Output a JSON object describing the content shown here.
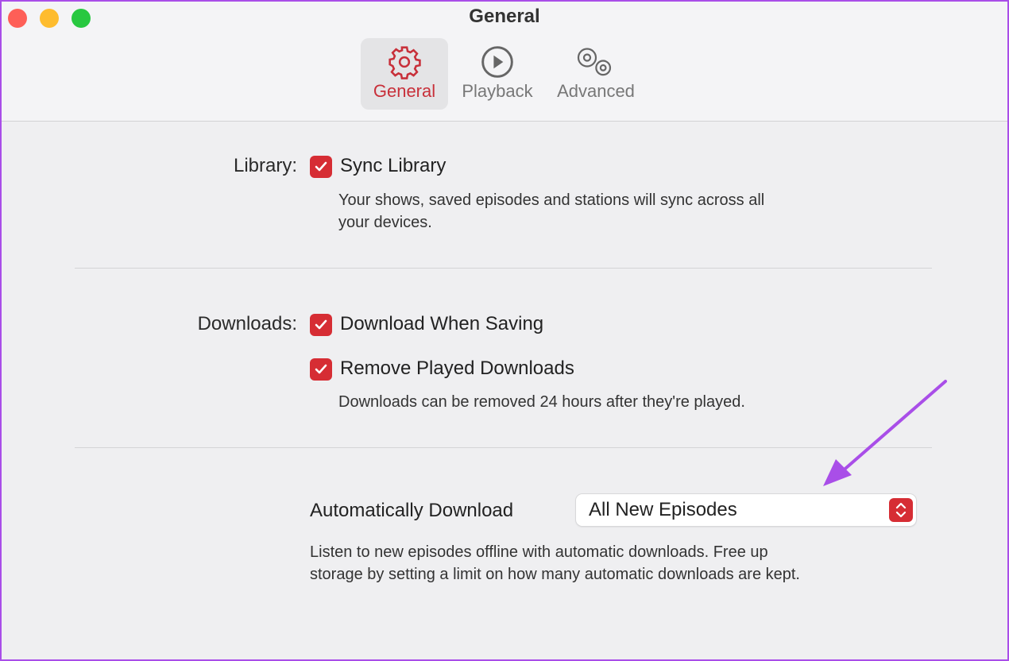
{
  "window": {
    "title": "General"
  },
  "tabs": [
    {
      "label": "General",
      "icon": "gear-icon",
      "selected": true
    },
    {
      "label": "Playback",
      "icon": "play-circle-icon"
    },
    {
      "label": "Advanced",
      "icon": "gears-icon"
    }
  ],
  "library": {
    "label": "Library:",
    "option": "Sync Library",
    "checked": true,
    "description_1": "Your shows, saved episodes and stations will sync across all",
    "description_2": "your devices."
  },
  "downloads": {
    "label": "Downloads:",
    "option1": "Download When Saving",
    "option1_checked": true,
    "option2": "Remove Played Downloads",
    "option2_checked": true,
    "description": "Downloads can be removed 24 hours after they're played."
  },
  "auto": {
    "label": "Automatically Download",
    "value": "All New Episodes",
    "description_1": "Listen to new episodes offline with automatic downloads. Free up",
    "description_2": "storage by setting a limit on how many automatic downloads are kept."
  },
  "colors": {
    "accent": "#d62d34",
    "annotation": "#a94ee8"
  }
}
